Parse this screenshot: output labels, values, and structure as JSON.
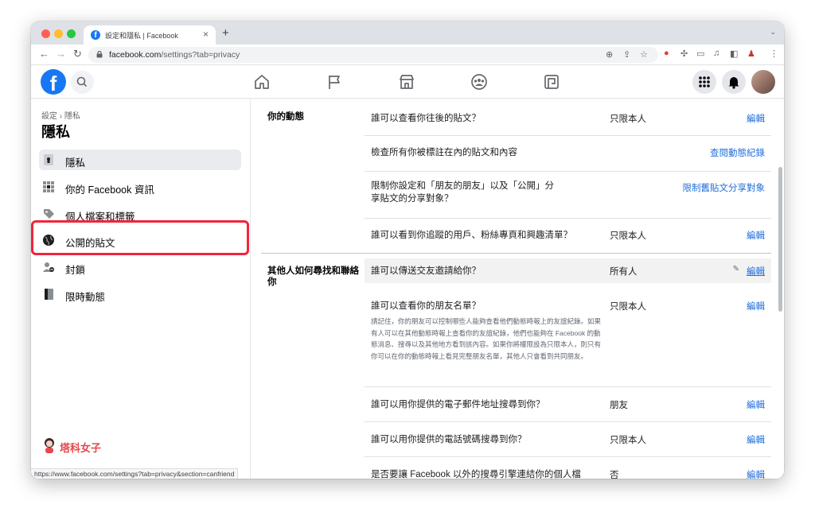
{
  "browser": {
    "tab_title": "設定和隱私 | Facebook",
    "tab_favicon": "f",
    "tab_close": "×",
    "new_tab": "+",
    "tab_menu": "⌄",
    "url_host": "facebook.com",
    "url_path": "/settings?tab=privacy",
    "status_url": "https://www.facebook.com/settings?tab=privacy&section=canfriend"
  },
  "fb": {
    "logo": "f",
    "header_nav": [
      "home-icon",
      "flag-icon",
      "marketplace-icon",
      "groups-icon",
      "gaming-icon"
    ]
  },
  "sidebar": {
    "breadcrumb": "設定 › 隱私",
    "title": "隱私",
    "items": [
      {
        "label": "隱私",
        "icon": "lock-icon",
        "active": true
      },
      {
        "label": "你的 Facebook 資訊",
        "icon": "grid-icon"
      },
      {
        "label": "個人檔案和標籤",
        "icon": "tag-icon"
      },
      {
        "label": "公開的貼文",
        "icon": "globe-icon"
      },
      {
        "label": "封鎖",
        "icon": "block-user-icon"
      },
      {
        "label": "限時動態",
        "icon": "book-icon"
      }
    ],
    "watermark": "塔科女子"
  },
  "main": {
    "section1": {
      "title": "你的動態",
      "rows": [
        {
          "question": "誰可以查看你往後的貼文？",
          "value": "只限本人",
          "action": "編輯"
        },
        {
          "question": "檢查所有你被標註在內的貼文和內容",
          "value": "",
          "action": "查閱動態紀錄"
        },
        {
          "question": "限制你設定和「朋友的朋友」以及「公開」分享貼文的分享對象？",
          "value": "",
          "action": "限制舊貼文分享對象"
        },
        {
          "question": "誰可以看到你追蹤的用戶、粉絲專頁和興趣清單？",
          "value": "只限本人",
          "action": "編輯"
        }
      ]
    },
    "section2": {
      "title": "其他人如何尋找和聯絡你",
      "rows": [
        {
          "question": "誰可以傳送交友邀請給你？",
          "value": "所有人",
          "action": "編輯"
        },
        {
          "question": "誰可以查看你的朋友名單？",
          "value": "只限本人",
          "action": "編輯",
          "description": "請記住，你的朋友可以控制哪些人能夠查看他們動態時報上的友誼紀錄。如果有人可以在其他動態時報上查看你的友誼紀錄，他們也能夠在 Facebook 的動態消息、搜尋以及其他地方看到該內容。如果你將權限設為只限本人，則只有你可以在你的動態時報上看見完整朋友名單，其他人只會看到共同朋友。"
        },
        {
          "question": "誰可以用你提供的電子郵件地址搜尋到你？",
          "value": "朋友",
          "action": "編輯"
        },
        {
          "question": "誰可以用你提供的電話號碼搜尋到你？",
          "value": "只限本人",
          "action": "編輯"
        },
        {
          "question": "是否要讓 Facebook 以外的搜尋引擎連結你的個人檔",
          "value": "否",
          "action": "編輯"
        }
      ]
    }
  },
  "colors": {
    "brand": "#1877f2",
    "link": "#216fdb",
    "highlight": "#f0253c",
    "watermark": "#e5484d"
  }
}
